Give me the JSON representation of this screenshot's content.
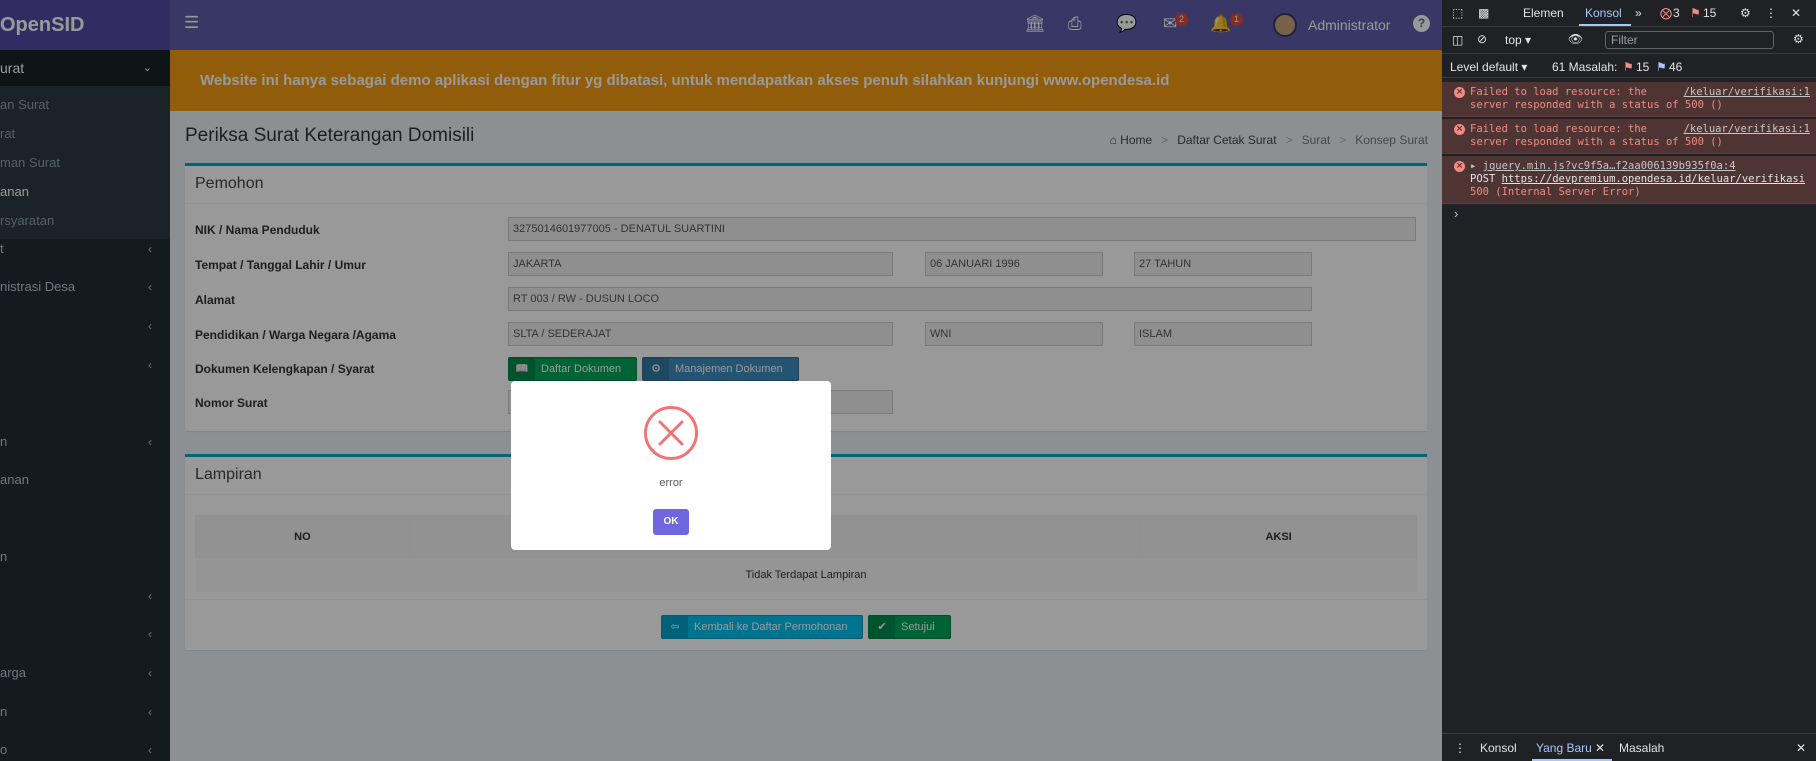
{
  "sidebar": {
    "logo": "OpenSID",
    "parent": "urat",
    "sub_items": [
      "an Surat",
      "rat",
      "man Surat",
      "anan",
      "rsyaratan"
    ],
    "items": [
      "t",
      "nistrasi Desa",
      "",
      "",
      "n",
      "anan",
      "",
      "n",
      "",
      "",
      "arga",
      "n",
      "o"
    ]
  },
  "topbar": {
    "user": "Administrator",
    "mail_badge": "2",
    "notif_badge": "1"
  },
  "banner": "Website ini hanya sebagai demo aplikasi dengan fitur yg dibatasi, untuk mendapatkan akses penuh silahkan kunjungi www.opendesa.id",
  "page": {
    "title": "Periksa Surat Keterangan Domisili",
    "breadcrumb": [
      "Home",
      "Daftar Cetak Surat",
      "Surat",
      "Konsep Surat"
    ]
  },
  "pemohon": {
    "header": "Pemohon",
    "labels": {
      "nik": "NIK / Nama Penduduk",
      "ttl": "Tempat / Tanggal Lahir / Umur",
      "alamat": "Alamat",
      "pendidikan": "Pendidikan / Warga Negara /Agama",
      "dokumen": "Dokumen Kelengkapan / Syarat",
      "nomor": "Nomor Surat"
    },
    "values": {
      "nik": "3275014601977005 - DENATUL SUARTINI",
      "tempat": "JAKARTA",
      "tanggal": "06 JANUARI 1996",
      "umur": "27 TAHUN",
      "alamat": " RT 003 / RW - DUSUN LOCO",
      "pendidikan": "SLTA / SEDERAJAT",
      "warga": "WNI",
      "agama": "ISLAM"
    },
    "buttons": {
      "daftar": "Daftar Dokumen",
      "manajemen": "Manajemen Dokumen"
    }
  },
  "lampiran": {
    "header": "Lampiran",
    "columns": [
      "NO",
      "",
      "AKSI"
    ],
    "empty": "Tidak Terdapat Lampiran"
  },
  "actions": {
    "back": "Kembali ke Daftar Permohonan",
    "approve": "Setujui"
  },
  "dialog": {
    "title": "error",
    "ok": "OK"
  },
  "devtools": {
    "tabs": [
      "Elemen",
      "Konsol"
    ],
    "error_count": "3",
    "warn_count": "15",
    "context": "top",
    "filter_placeholder": "Filter",
    "level": "Level default",
    "issues": "61 Masalah:",
    "issues_warn": "15",
    "issues_info": "46",
    "messages": [
      {
        "text": "Failed to load resource: the server responded with a status of 500 ()",
        "source": "/keluar/verifikasi:1"
      },
      {
        "text": "Failed to load resource: the server responded with a status of 500 ()",
        "source": "/keluar/verifikasi:1"
      },
      {
        "source": "jquery.min.js?vc9f5a…f2aa006139b935f0a:4",
        "method": "POST",
        "url": "https://devpremium.opendesa.id/keluar/verifikasi",
        "status": "500 (Internal Server Error)"
      }
    ],
    "bottom_tabs": [
      "Konsol",
      "Yang Baru",
      "Masalah"
    ]
  },
  "colors": {
    "topbar": "#605ca8",
    "banner": "#f39c12",
    "sidebar": "#222d32",
    "error": "#f27474",
    "ok_button": "#7066e0"
  }
}
